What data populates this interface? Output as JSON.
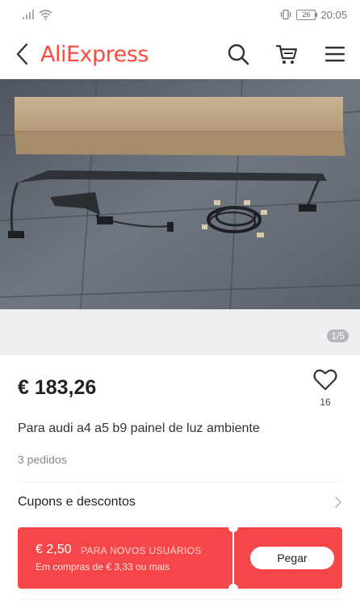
{
  "status_bar": {
    "battery": "26",
    "time": "20:05"
  },
  "header": {
    "logo": "AliExpress"
  },
  "gallery": {
    "counter": "1/5"
  },
  "product": {
    "price": "€ 183,26",
    "wishlist_count": "16",
    "title": "Para audi a4 a5 b9 painel de luz ambiente",
    "orders": "3 pedidos"
  },
  "coupons": {
    "section_label": "Cupons e descontos",
    "amount": "€ 2,50",
    "tag": "PARA NOVOS USUÁRIOS",
    "condition": "Em compras de € 3,33 ou mais",
    "button_label": "Pegar"
  },
  "colors": {
    "brand": "#ff4a3d",
    "coupon": "#f5464a"
  }
}
